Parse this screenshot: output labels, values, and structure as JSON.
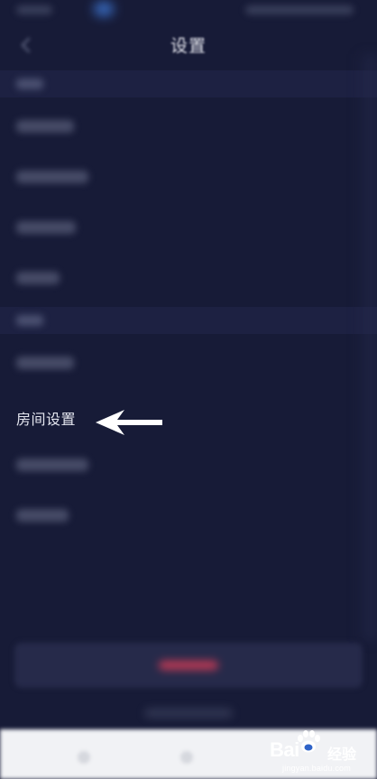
{
  "header": {
    "title": "设置"
  },
  "main": {
    "highlighted_item": {
      "label": "房间设置"
    }
  },
  "watermark": {
    "brand": "Bai",
    "brand_cn": "经验",
    "url": "jingyan.baidu.com"
  },
  "colors": {
    "background": "#171b37",
    "section_band": "#1d2142",
    "accent_red": "#c23a55",
    "nav_bar": "#f1f2f5"
  }
}
